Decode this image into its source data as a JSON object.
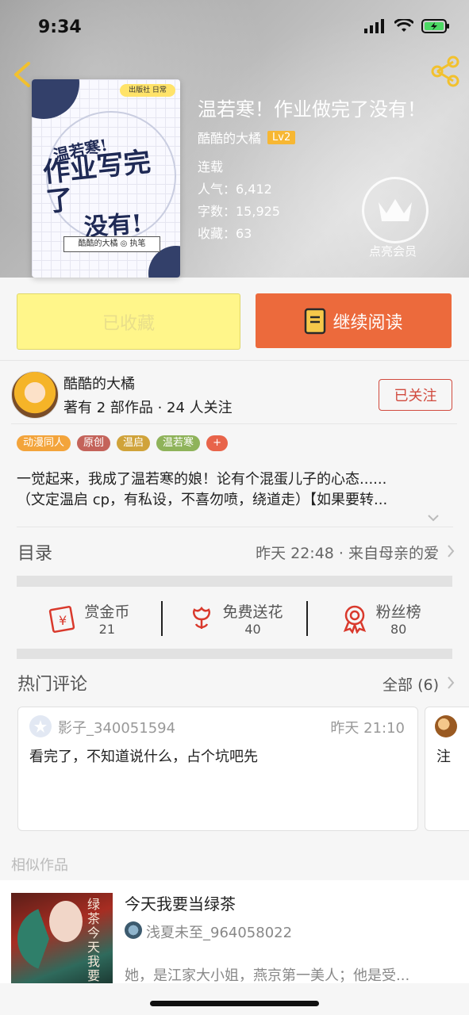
{
  "status": {
    "time": "9:34"
  },
  "book": {
    "title": "温若寒！作业做完了没有！",
    "author": "酷酷的大橘",
    "level": "Lv2",
    "status": "连载",
    "popularity": "人气：6,412",
    "word_count": "字数：15,925",
    "favorites": "收藏：63",
    "vip_label": "点亮会员",
    "cover_text": {
      "line1": "温若寒!",
      "line2": "作业写完了",
      "line3": "没有!",
      "author_line": "酷酷的大橘 ◎ 执笔",
      "badge": "出版社 日常"
    }
  },
  "actions": {
    "collected_label": "已收藏",
    "continue_label": "继续阅读"
  },
  "author_block": {
    "name": "酷酷的大橘",
    "stats": "著有 2 部作品 · 24 人关注",
    "follow_label": "已关注"
  },
  "tags": [
    {
      "label": "动漫同人",
      "color": "#f3a43b"
    },
    {
      "label": "原创",
      "color": "#c4635a"
    },
    {
      "label": "温启",
      "color": "#d0a33a"
    },
    {
      "label": "温若寒",
      "color": "#8fb35a"
    },
    {
      "label": "+",
      "color": "#e8644a"
    }
  ],
  "synopsis": {
    "line1": "一觉起来，我成了温若寒的娘！论有个混蛋儿子的心态......",
    "line2": "（文定温启 cp，有私设，不喜勿喷，绕道走）【如果要转..."
  },
  "toc": {
    "label": "目录",
    "latest": "昨天 22:48 · 来自母亲的爱"
  },
  "rewards": [
    {
      "label": "赏金币",
      "count": "21",
      "icon": "red-envelope-icon"
    },
    {
      "label": "免费送花",
      "count": "40",
      "icon": "flower-icon"
    },
    {
      "label": "粉丝榜",
      "count": "80",
      "icon": "medal-icon"
    }
  ],
  "hot_comments": {
    "label": "热门评论",
    "all_label": "全部 (6)",
    "items": [
      {
        "user": "影子_340051594",
        "time": "昨天 21:10",
        "text": "看完了，不知道说什么，占个坑吧先"
      },
      {
        "text": "注"
      }
    ]
  },
  "similar": {
    "label": "相似作品",
    "items": [
      {
        "title": "今天我要当绿茶",
        "author": "浅夏未至_964058022",
        "desc": "她，是江家大小姐，燕京第一美人；他是受...",
        "cover_text": "绿茶今天我要当"
      }
    ]
  },
  "colors": {
    "accent": "#ec6a3c",
    "collected_bg": "#fff68a",
    "follow": "#d14a3e",
    "reward_red": "#d9392c"
  }
}
